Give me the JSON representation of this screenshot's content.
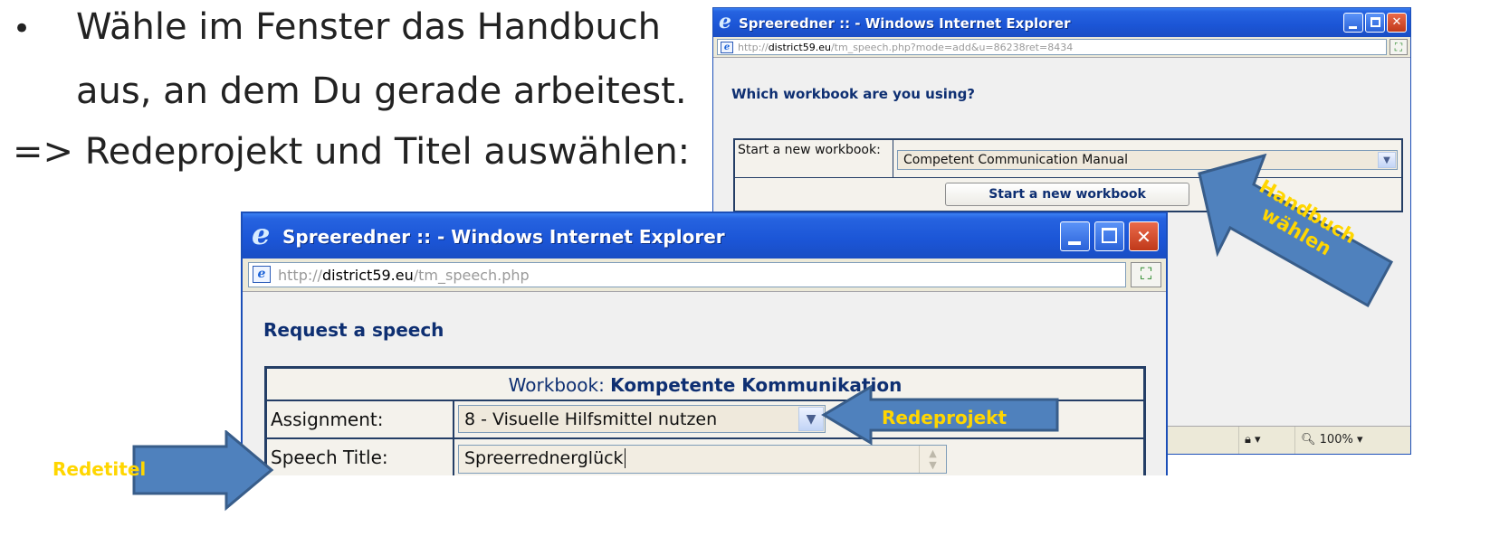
{
  "slide": {
    "bullet_symbol": "•",
    "bullet_line1": "Wähle im Fenster das Handbuch",
    "bullet_line2": "aus, an dem Du gerade arbeitest.",
    "arrow_line": "=> Redeprojekt und Titel auswählen:"
  },
  "back_window": {
    "title": "Spreeredner :: - Windows Internet Explorer",
    "url_prefix": "http://",
    "url_domain": "district59.eu",
    "url_path": "/tm_speech.php?mode=add&u=86238ret=8434",
    "heading": "Which workbook are you using?",
    "new_workbook_label": "Start a new workbook:",
    "workbook_select_value": "Competent Communication Manual",
    "start_button_label": "Start a new workbook",
    "status_zoom": "100%"
  },
  "front_window": {
    "title": "Spreeredner :: - Windows Internet Explorer",
    "url_prefix": "http://",
    "url_domain": "district59.eu",
    "url_path": "/tm_speech.php",
    "heading": "Request a speech",
    "workbook_caption_prefix": "Workbook:",
    "workbook_name": "Kompetente Kommunikation",
    "assignment_label": "Assignment:",
    "assignment_value": "8 - Visuelle Hilfsmittel nutzen",
    "speech_title_label": "Speech Title:",
    "speech_title_value": "Spreerrednerglück"
  },
  "annotations": {
    "handbuch": "Handbuch wählen",
    "handbuch_line1": "Handbuch",
    "handbuch_line2": "wählen",
    "redeprojekt": "Redeprojekt",
    "redetitel": "Redetitel"
  },
  "colors": {
    "arrow_fill": "#4f81bd",
    "arrow_stroke": "#385d8a",
    "label_text": "#ffd600",
    "titlebar_blue": "#1b55d6",
    "heading_navy": "#0e2f72"
  },
  "icons": {
    "ie_logo": "ie-logo-icon",
    "minimize": "minimize-icon",
    "maximize": "maximize-icon",
    "close": "close-icon",
    "dropdown": "chevron-down-icon",
    "compat": "compatibility-view-icon",
    "zoom": "zoom-icon",
    "security": "security-zone-icon"
  }
}
